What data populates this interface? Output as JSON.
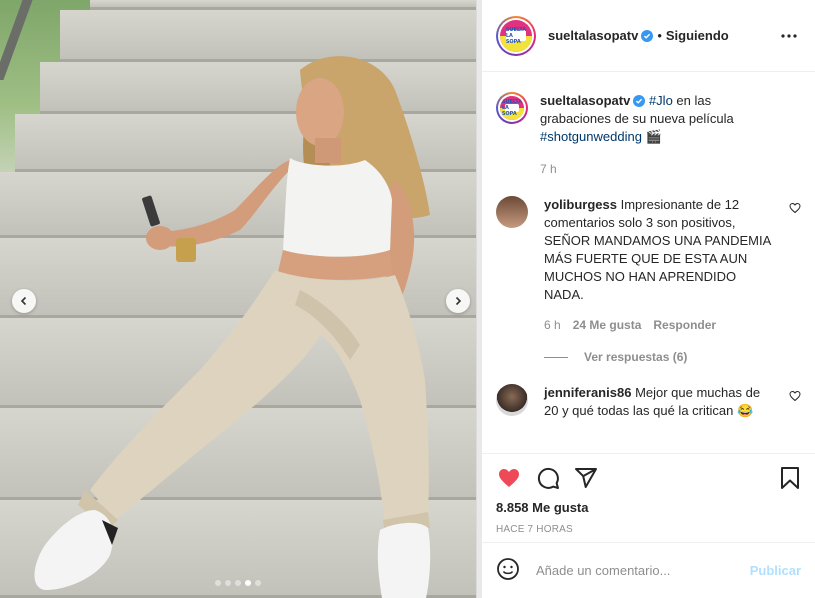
{
  "post": {
    "username": "sueltalasopatv",
    "logo_text": "SUELTA LA SOPA",
    "follow_status": "Siguiendo",
    "caption": {
      "hashtag1": "#Jlo",
      "text": " en las grabaciones de su nueva película ",
      "hashtag2": "#shotgunwedding",
      "emoji": "🎬",
      "time": "7 h"
    },
    "image_dots": 5,
    "active_dot": 3
  },
  "comments": [
    {
      "username": "yoliburgess",
      "text": "Impresionante de 12 comentarios solo 3 son positivos, SEÑOR MANDAMOS UNA PANDEMIA MÁS FUERTE QUE DE ESTA AUN MUCHOS NO HAN APRENDIDO NADA.",
      "time": "6 h",
      "likes": "24 Me gusta",
      "reply": "Responder",
      "view_replies": "Ver respuestas (6)"
    },
    {
      "username": "jenniferanis86",
      "text": "Mejor que muchas de 20 y qué todas las qué la critican 😂"
    }
  ],
  "actions": {
    "likes_count": "8.858 Me gusta",
    "timestamp": "HACE 7 HORAS"
  },
  "add_comment": {
    "placeholder": "Añade un comentario...",
    "post_label": "Publicar"
  },
  "colors": {
    "like_red": "#ed4956",
    "link_blue": "#00376b",
    "verified_blue": "#3897f0",
    "publish_disabled": "#b2dffc"
  }
}
